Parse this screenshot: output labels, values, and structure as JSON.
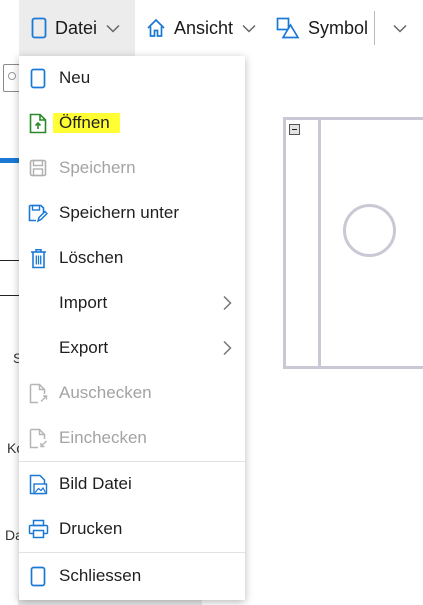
{
  "toolbar": {
    "datei_label": "Datei",
    "ansicht_label": "Ansicht",
    "symbol_label": "Symbol"
  },
  "background": {
    "letter_s": "S",
    "letter_ko": "Ko",
    "letter_da": "Da"
  },
  "menu": {
    "items": [
      {
        "label": "Neu",
        "icon": "new-document-icon",
        "enabled": true
      },
      {
        "label": "Öffnen",
        "icon": "open-file-icon",
        "enabled": true,
        "highlighted": true
      },
      {
        "label": "Speichern",
        "icon": "save-icon",
        "enabled": false
      },
      {
        "label": "Speichern unter",
        "icon": "save-as-icon",
        "enabled": true
      },
      {
        "label": "Löschen",
        "icon": "trash-icon",
        "enabled": true
      },
      {
        "label": "Import",
        "icon": "",
        "enabled": true,
        "submenu": true
      },
      {
        "label": "Export",
        "icon": "",
        "enabled": true,
        "submenu": true
      },
      {
        "label": "Auschecken",
        "icon": "checkout-icon",
        "enabled": false
      },
      {
        "label": "Einchecken",
        "icon": "checkin-icon",
        "enabled": false
      },
      {
        "label": "Bild Datei",
        "icon": "image-file-icon",
        "enabled": true
      },
      {
        "label": "Drucken",
        "icon": "printer-icon",
        "enabled": true
      },
      {
        "label": "Schliessen",
        "icon": "close-document-icon",
        "enabled": true
      }
    ]
  },
  "colors": {
    "accent": "#1b79d6",
    "highlight": "#ffff33",
    "disabled_text": "#a3a3a3",
    "diagram_stroke": "#c9c9d5"
  }
}
